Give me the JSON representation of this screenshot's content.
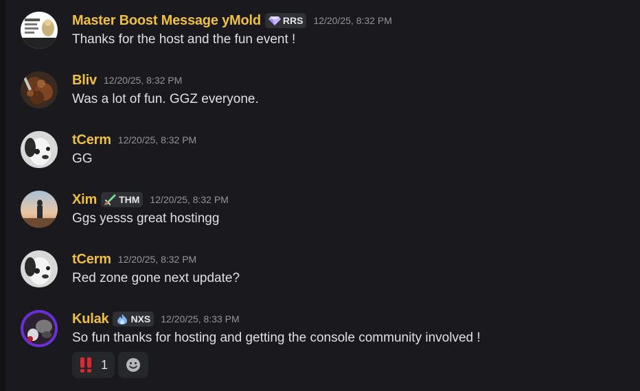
{
  "messages": [
    {
      "author": "Master Boost Message yMold",
      "tag": {
        "label": "RRS",
        "icon": "gem-icon"
      },
      "timestamp": "12/20/25, 8:32 PM",
      "content": "Thanks for the host and the fun event !",
      "avatar": "poster-avatar"
    },
    {
      "author": "Bliv",
      "timestamp": "12/20/25, 8:32 PM",
      "content": "Was a lot of fun.  GGZ everyone.",
      "avatar": "food-avatar"
    },
    {
      "author": "tCerm",
      "timestamp": "12/20/25, 8:32 PM",
      "content": "GG",
      "avatar": "dog-avatar"
    },
    {
      "author": "Xim",
      "tag": {
        "label": "THM",
        "icon": "sword-icon"
      },
      "timestamp": "12/20/25, 8:32 PM",
      "content": "Ggs yesss great hostingg",
      "avatar": "sunset-avatar"
    },
    {
      "author": "tCerm",
      "timestamp": "12/20/25, 8:32 PM",
      "content": "Red zone gone next update?",
      "avatar": "dog-avatar"
    },
    {
      "author": "Kulak",
      "tag": {
        "label": "NXS",
        "icon": "flame-icon"
      },
      "timestamp": "12/20/25, 8:33 PM",
      "content": "So fun thanks for hosting and getting the console community involved !",
      "avatar": "purple-avatar",
      "reactions": [
        {
          "emoji": "‼️",
          "icon": "double-exclamation-icon",
          "count": "1"
        }
      ]
    }
  ],
  "colors": {
    "background": "#1a1a1e",
    "username": "#f0c040",
    "timestamp": "#94959c",
    "text": "#dfe0e3",
    "tag_bg": "#2f3034",
    "reaction_bg": "#26272b"
  }
}
